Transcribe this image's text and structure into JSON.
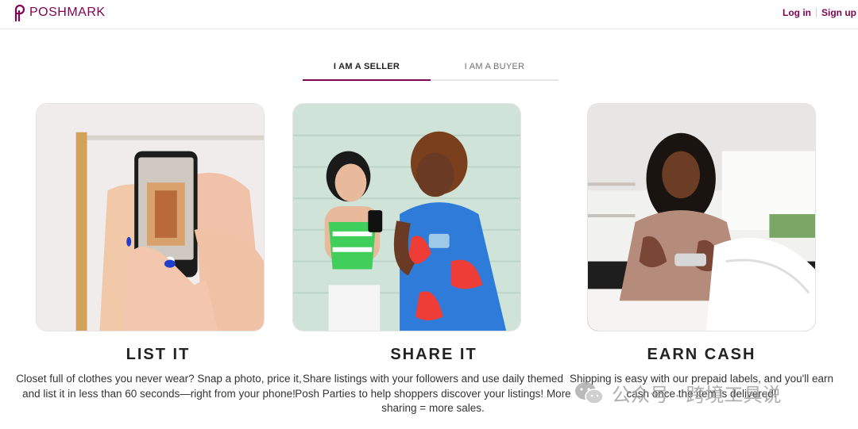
{
  "brand": {
    "name": "POSHMARK",
    "color": "#7f0353"
  },
  "header": {
    "login_label": "Log in",
    "signup_label": "Sign up"
  },
  "tabs": [
    {
      "label": "I AM A SELLER",
      "active": true
    },
    {
      "label": "I AM A BUYER",
      "active": false
    }
  ],
  "steps": [
    {
      "title": "LIST IT",
      "text": "Closet full of clothes you never wear? Snap a photo, price it, and list it in less than 60 seconds—right from your phone!"
    },
    {
      "title": "SHARE IT",
      "text": "Share listings with your followers and use daily themed Posh Parties to help shoppers discover your listings! More sharing = more sales."
    },
    {
      "title": "EARN CASH",
      "text": "Shipping is easy with our prepaid labels, and you'll earn cash once the item is delivered!"
    }
  ],
  "watermark": {
    "text": "公众号 · 跨境工具说"
  }
}
